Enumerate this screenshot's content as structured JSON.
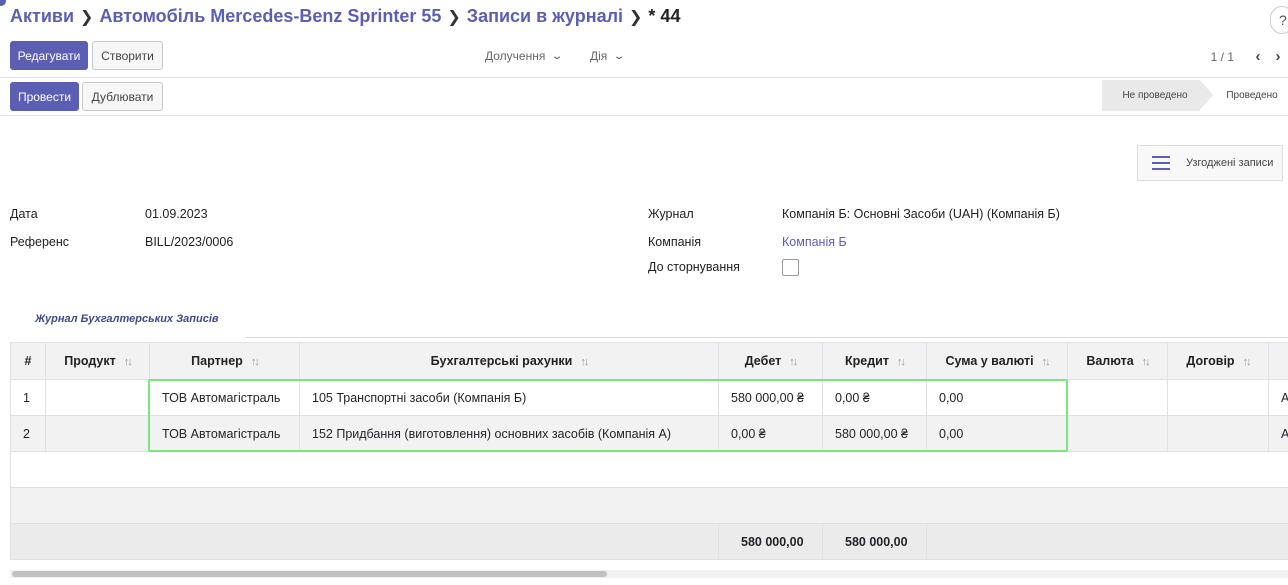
{
  "breadcrumb": {
    "items": [
      "Активи",
      "Автомобіль Mercedes-Benz Sprinter 55",
      "Записи в журналі"
    ],
    "current": "* 44"
  },
  "help_label": "?",
  "toolbar": {
    "edit_label": "Редагувати",
    "create_label": "Створити",
    "print_label": "Долучення",
    "action_label": "Дія",
    "pager_value": "1 / 1"
  },
  "actions": {
    "post_label": "Провести",
    "duplicate_label": "Дублювати"
  },
  "status": {
    "stages": [
      "Не проведено",
      "Проведено"
    ],
    "current": "Не проведено"
  },
  "smart_button": {
    "label": "Узгоджені записи",
    "icon": "list-icon"
  },
  "form": {
    "date_label": "Дата",
    "date_value": "01.09.2023",
    "ref_label": "Референс",
    "ref_value": "BILL/2023/0006",
    "journal_label": "Журнал",
    "journal_value": "Компанія Б: Основні Засоби (UAH) (Компанія Б)",
    "company_label": "Компанія",
    "company_value": "Компанія Б",
    "reverse_label": "До сторнування",
    "reverse_checked": false
  },
  "tab": {
    "label": "Журнал Бухгалтерських Записів"
  },
  "table": {
    "columns": [
      "#",
      "Продукт",
      "Партнер",
      "Бухгалтерські рахунки",
      "Дебет",
      "Кредит",
      "Сума у валюті",
      "Валюта",
      "Договір"
    ],
    "rows": [
      {
        "idx": "1",
        "product": "",
        "partner": "ТОВ Автомагістраль",
        "account": "105 Транспортні засоби (Компанія Б)",
        "debit": "580 000,00 ₴",
        "credit": "0,00 ₴",
        "amount_currency": "0,00",
        "currency": "",
        "contract": "",
        "extra": "А"
      },
      {
        "idx": "2",
        "product": "",
        "partner": "ТОВ Автомагістраль",
        "account": "152 Придбання (виготовлення) основних засобів (Компанія А)",
        "debit": "0,00 ₴",
        "credit": "580 000,00 ₴",
        "amount_currency": "0,00",
        "currency": "",
        "contract": "",
        "extra": "А"
      }
    ],
    "totals": {
      "debit": "580 000,00",
      "credit": "580 000,00"
    }
  },
  "colors": {
    "accent": "#5b5fb4",
    "highlight": "#7ce67c"
  }
}
